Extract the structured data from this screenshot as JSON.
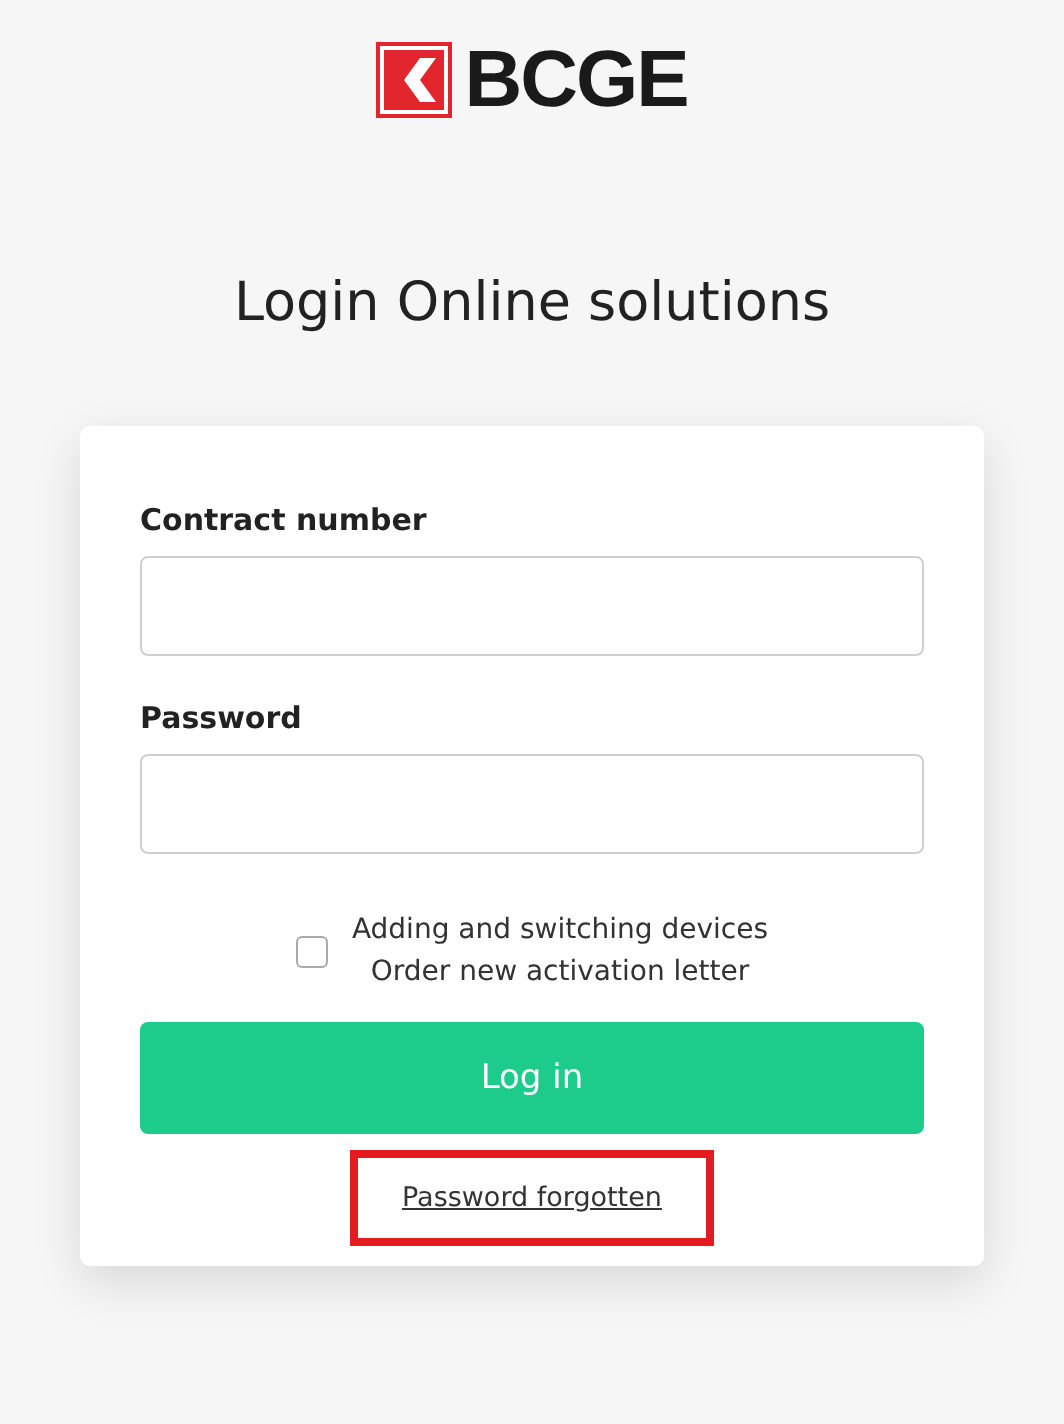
{
  "logo": {
    "text": "BCGE"
  },
  "title": "Login Online solutions",
  "form": {
    "fields": [
      {
        "label": "Contract number"
      },
      {
        "label": "Password"
      }
    ],
    "option": {
      "checked": false,
      "lines": [
        "Adding and switching devices",
        "Order new activation letter"
      ]
    },
    "submit": "Log in",
    "link": {
      "text": "Password forgotten",
      "highlighted": true
    }
  }
}
